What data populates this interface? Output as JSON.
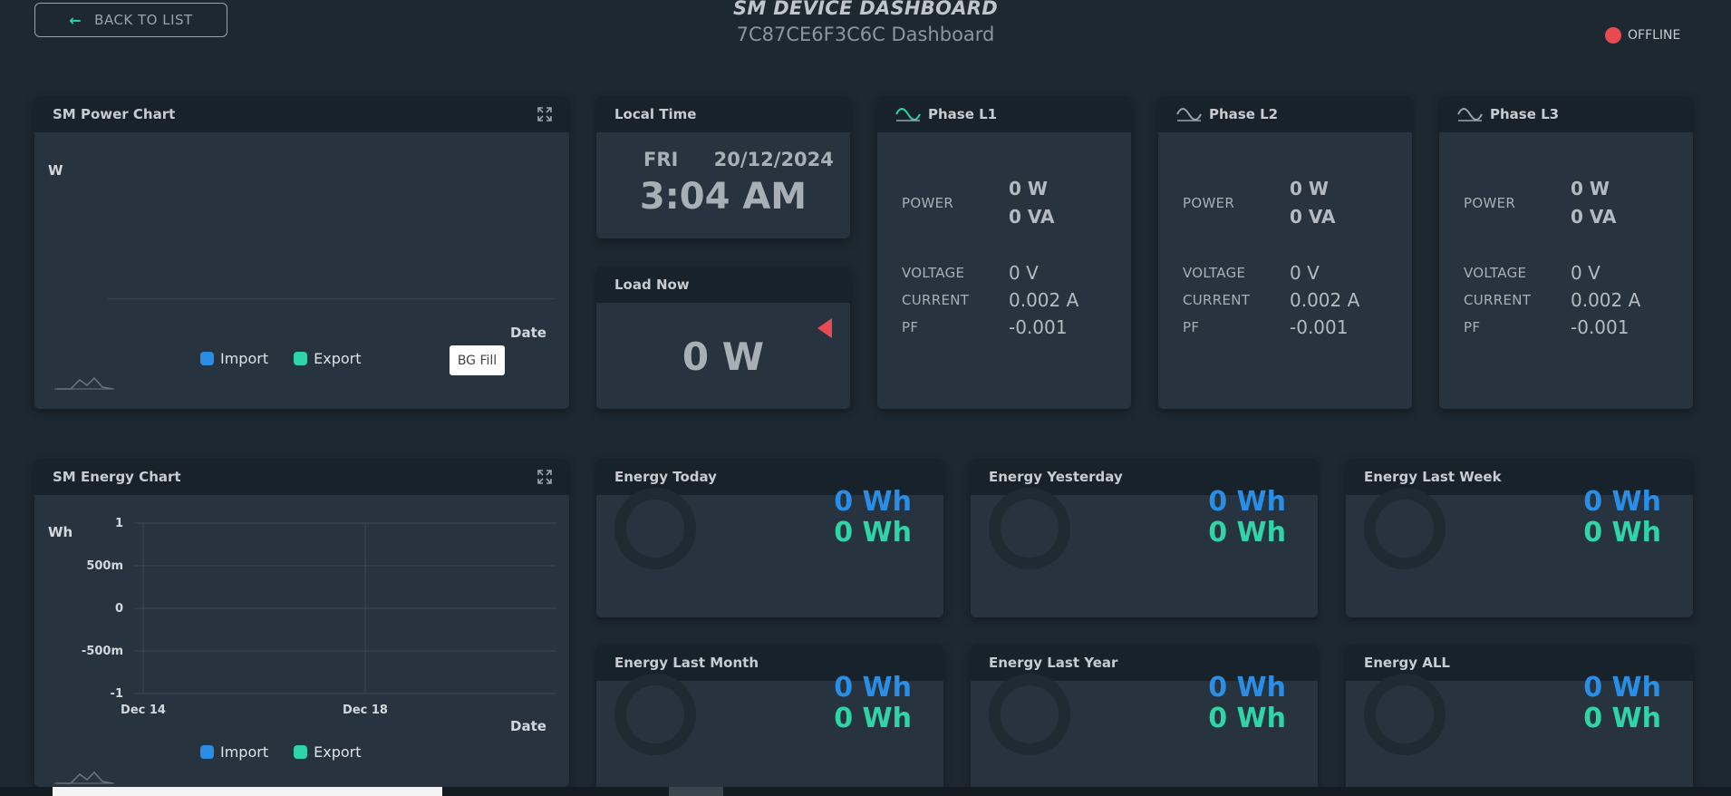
{
  "header": {
    "back_label": "BACK TO LIST",
    "title": "SM DEVICE DASHBOARD",
    "subtitle": "7C87CE6F3C6C Dashboard",
    "status": "OFFLINE",
    "status_color": "#e84a52"
  },
  "power_chart": {
    "title": "SM Power Chart",
    "unit": "W",
    "x_label": "Date",
    "legend": [
      {
        "label": "Import",
        "color": "#2a8ee6"
      },
      {
        "label": "Export",
        "color": "#2fd5a8"
      }
    ],
    "bg_fill_label": "BG Fill"
  },
  "local_time": {
    "title": "Local Time",
    "day": "FRI",
    "date": "20/12/2024",
    "time": "3:04 AM"
  },
  "load_now": {
    "title": "Load Now",
    "value": "0 W"
  },
  "phases": [
    {
      "title": "Phase L1",
      "power_label": "POWER",
      "power_w": "0 W",
      "power_va": "0 VA",
      "voltage_label": "VOLTAGE",
      "voltage": "0 V",
      "current_label": "CURRENT",
      "current": "0.002 A",
      "pf_label": "PF",
      "pf": "-0.001"
    },
    {
      "title": "Phase L2",
      "power_label": "POWER",
      "power_w": "0 W",
      "power_va": "0 VA",
      "voltage_label": "VOLTAGE",
      "voltage": "0 V",
      "current_label": "CURRENT",
      "current": "0.002 A",
      "pf_label": "PF",
      "pf": "-0.001"
    },
    {
      "title": "Phase L3",
      "power_label": "POWER",
      "power_w": "0 W",
      "power_va": "0 VA",
      "voltage_label": "VOLTAGE",
      "voltage": "0 V",
      "current_label": "CURRENT",
      "current": "0.002 A",
      "pf_label": "PF",
      "pf": "-0.001"
    }
  ],
  "energy_chart": {
    "title": "SM Energy Chart",
    "unit": "Wh",
    "x_label": "Date",
    "legend": [
      {
        "label": "Import",
        "color": "#2a8ee6"
      },
      {
        "label": "Export",
        "color": "#2fd5a8"
      }
    ]
  },
  "chart_data": {
    "type": "line",
    "title": "SM Energy Chart",
    "ylabel": "Wh",
    "xlabel": "Date",
    "y_ticks": [
      "1",
      "500m",
      "0",
      "-500m",
      "-1"
    ],
    "ylim": [
      -1,
      1
    ],
    "x_ticks": [
      "Dec 14",
      "Dec 18"
    ],
    "grid": true,
    "legend_position": "bottom",
    "series": [
      {
        "name": "Import",
        "values": []
      },
      {
        "name": "Export",
        "values": []
      }
    ]
  },
  "energy_cards": [
    {
      "title": "Energy Today",
      "import": "0 Wh",
      "export": "0 Wh"
    },
    {
      "title": "Energy Yesterday",
      "import": "0 Wh",
      "export": "0 Wh"
    },
    {
      "title": "Energy Last Week",
      "import": "0 Wh",
      "export": "0 Wh"
    },
    {
      "title": "Energy Last Month",
      "import": "0 Wh",
      "export": "0 Wh"
    },
    {
      "title": "Energy Last Year",
      "import": "0 Wh",
      "export": "0 Wh"
    },
    {
      "title": "Energy ALL",
      "import": "0 Wh",
      "export": "0 Wh"
    }
  ],
  "icons": {
    "back": "arrow-left-icon",
    "expand": "expand-icon",
    "phase": "sine-wave-icon",
    "status": "status-dot-icon"
  }
}
